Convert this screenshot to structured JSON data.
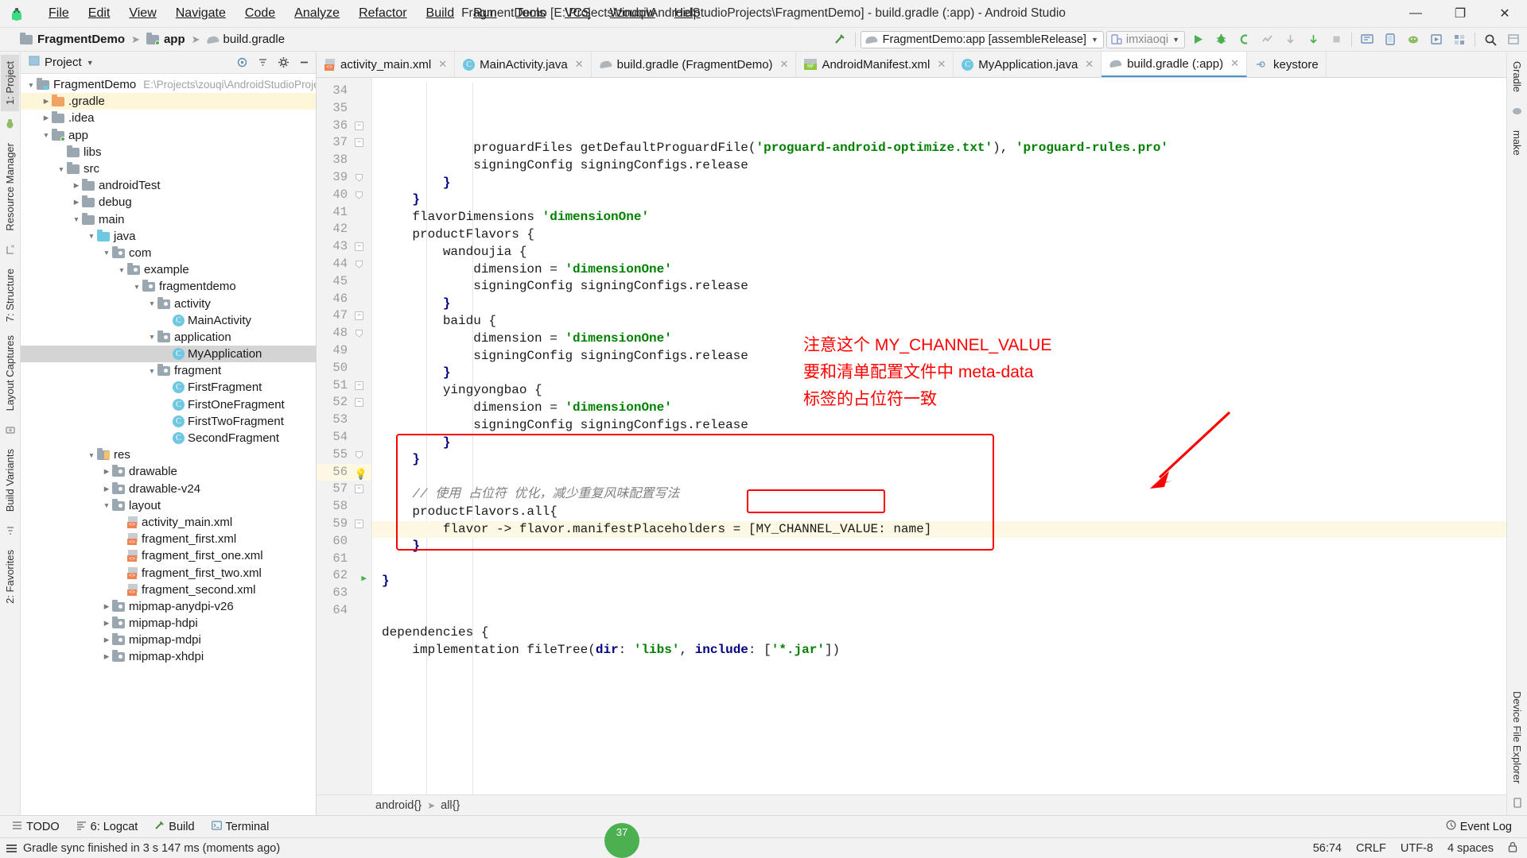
{
  "window": {
    "title": "FragmentDemo [E:\\Projects\\zouqi\\AndroidStudioProjects\\FragmentDemo] - build.gradle (:app) - Android Studio",
    "minimize": "—",
    "maximize": "❐",
    "close": "✕"
  },
  "menubar": [
    {
      "label": "File"
    },
    {
      "label": "Edit"
    },
    {
      "label": "View"
    },
    {
      "label": "Navigate"
    },
    {
      "label": "Code"
    },
    {
      "label": "Analyze"
    },
    {
      "label": "Refactor"
    },
    {
      "label": "Build"
    },
    {
      "label": "Run"
    },
    {
      "label": "Tools"
    },
    {
      "label": "VCS"
    },
    {
      "label": "Window"
    },
    {
      "label": "Help"
    }
  ],
  "breadcrumb": [
    {
      "label": "FragmentDemo",
      "icon": "folder-icon"
    },
    {
      "label": "app",
      "icon": "module-icon"
    },
    {
      "label": "build.gradle",
      "icon": "gradle-icon"
    }
  ],
  "toolbar": {
    "run_config": "FragmentDemo:app [assembleRelease]",
    "device": "imxiaoqi",
    "caret": "▼"
  },
  "left_rail": {
    "top_tab": "1: Project",
    "tabs": [
      "Resource Manager",
      "7: Structure",
      "Layout Captures",
      "Build Variants",
      "2: Favorites"
    ]
  },
  "right_rail": {
    "tabs": [
      "Gradle",
      "make",
      "Device File Explorer",
      "Event Log"
    ]
  },
  "project_panel": {
    "title": "Project",
    "caret": "▼",
    "tree": [
      {
        "depth": 0,
        "arrow": "▼",
        "icon": "folder-project",
        "label": "FragmentDemo",
        "path": "E:\\Projects\\zouqi\\AndroidStudioProject",
        "state": "normal"
      },
      {
        "depth": 1,
        "arrow": "▶",
        "icon": "folder-orange",
        "label": ".gradle",
        "path": "",
        "state": "hl"
      },
      {
        "depth": 1,
        "arrow": "▶",
        "icon": "folder-gray",
        "label": ".idea",
        "path": "",
        "state": "normal"
      },
      {
        "depth": 1,
        "arrow": "▼",
        "icon": "folder-module",
        "label": "app",
        "path": "",
        "state": "normal"
      },
      {
        "depth": 2,
        "arrow": "",
        "icon": "folder-gray",
        "label": "libs",
        "path": "",
        "state": "normal"
      },
      {
        "depth": 2,
        "arrow": "▼",
        "icon": "folder-gray",
        "label": "src",
        "path": "",
        "state": "normal"
      },
      {
        "depth": 3,
        "arrow": "▶",
        "icon": "folder-gray",
        "label": "androidTest",
        "path": "",
        "state": "normal"
      },
      {
        "depth": 3,
        "arrow": "▶",
        "icon": "folder-gray",
        "label": "debug",
        "path": "",
        "state": "normal"
      },
      {
        "depth": 3,
        "arrow": "▼",
        "icon": "folder-gray",
        "label": "main",
        "path": "",
        "state": "normal"
      },
      {
        "depth": 4,
        "arrow": "▼",
        "icon": "folder-blue",
        "label": "java",
        "path": "",
        "state": "normal"
      },
      {
        "depth": 5,
        "arrow": "▼",
        "icon": "folder-pkg",
        "label": "com",
        "path": "",
        "state": "normal"
      },
      {
        "depth": 6,
        "arrow": "▼",
        "icon": "folder-pkg",
        "label": "example",
        "path": "",
        "state": "normal"
      },
      {
        "depth": 7,
        "arrow": "▼",
        "icon": "folder-pkg",
        "label": "fragmentdemo",
        "path": "",
        "state": "normal"
      },
      {
        "depth": 8,
        "arrow": "▼",
        "icon": "folder-pkg",
        "label": "activity",
        "path": "",
        "state": "normal"
      },
      {
        "depth": 9,
        "arrow": "",
        "icon": "class-icon",
        "label": "MainActivity",
        "path": "",
        "state": "normal"
      },
      {
        "depth": 8,
        "arrow": "▼",
        "icon": "folder-pkg",
        "label": "application",
        "path": "",
        "state": "normal"
      },
      {
        "depth": 9,
        "arrow": "",
        "icon": "class-icon",
        "label": "MyApplication",
        "path": "",
        "state": "sel"
      },
      {
        "depth": 8,
        "arrow": "▼",
        "icon": "folder-pkg",
        "label": "fragment",
        "path": "",
        "state": "normal"
      },
      {
        "depth": 9,
        "arrow": "",
        "icon": "class-icon",
        "label": "FirstFragment",
        "path": "",
        "state": "normal"
      },
      {
        "depth": 9,
        "arrow": "",
        "icon": "class-icon",
        "label": "FirstOneFragment",
        "path": "",
        "state": "normal"
      },
      {
        "depth": 9,
        "arrow": "",
        "icon": "class-icon",
        "label": "FirstTwoFragment",
        "path": "",
        "state": "normal"
      },
      {
        "depth": 9,
        "arrow": "",
        "icon": "class-icon",
        "label": "SecondFragment",
        "path": "",
        "state": "normal"
      },
      {
        "depth": 4,
        "arrow": "▼",
        "icon": "folder-res",
        "label": "res",
        "path": "",
        "state": "normal"
      },
      {
        "depth": 5,
        "arrow": "▶",
        "icon": "folder-pkg",
        "label": "drawable",
        "path": "",
        "state": "normal"
      },
      {
        "depth": 5,
        "arrow": "▶",
        "icon": "folder-pkg",
        "label": "drawable-v24",
        "path": "",
        "state": "normal"
      },
      {
        "depth": 5,
        "arrow": "▼",
        "icon": "folder-pkg",
        "label": "layout",
        "path": "",
        "state": "normal"
      },
      {
        "depth": 6,
        "arrow": "",
        "icon": "xml-icon",
        "label": "activity_main.xml",
        "path": "",
        "state": "normal"
      },
      {
        "depth": 6,
        "arrow": "",
        "icon": "xml-icon",
        "label": "fragment_first.xml",
        "path": "",
        "state": "normal"
      },
      {
        "depth": 6,
        "arrow": "",
        "icon": "xml-icon",
        "label": "fragment_first_one.xml",
        "path": "",
        "state": "normal"
      },
      {
        "depth": 6,
        "arrow": "",
        "icon": "xml-icon",
        "label": "fragment_first_two.xml",
        "path": "",
        "state": "normal"
      },
      {
        "depth": 6,
        "arrow": "",
        "icon": "xml-icon",
        "label": "fragment_second.xml",
        "path": "",
        "state": "normal"
      },
      {
        "depth": 5,
        "arrow": "▶",
        "icon": "folder-pkg",
        "label": "mipmap-anydpi-v26",
        "path": "",
        "state": "normal"
      },
      {
        "depth": 5,
        "arrow": "▶",
        "icon": "folder-pkg",
        "label": "mipmap-hdpi",
        "path": "",
        "state": "normal"
      },
      {
        "depth": 5,
        "arrow": "▶",
        "icon": "folder-pkg",
        "label": "mipmap-mdpi",
        "path": "",
        "state": "normal"
      },
      {
        "depth": 5,
        "arrow": "▶",
        "icon": "folder-pkg",
        "label": "mipmap-xhdpi",
        "path": "",
        "state": "normal"
      }
    ]
  },
  "editor_tabs": [
    {
      "label": "activity_main.xml",
      "icon": "xml-icon",
      "active": false
    },
    {
      "label": "MainActivity.java",
      "icon": "class-icon",
      "active": false
    },
    {
      "label": "build.gradle (FragmentDemo)",
      "icon": "gradle-icon",
      "active": false
    },
    {
      "label": "AndroidManifest.xml",
      "icon": "manifest-icon",
      "active": false
    },
    {
      "label": "MyApplication.java",
      "icon": "class-icon",
      "active": false
    },
    {
      "label": "build.gradle (:app)",
      "icon": "gradle-icon",
      "active": true
    },
    {
      "label": "keystore",
      "icon": "keystore-icon",
      "active": false
    }
  ],
  "code": {
    "first_line_number": 34,
    "current_line": 56,
    "lines": [
      {
        "n": 34,
        "fold": "",
        "html": "            <span class='txt'>proguardFiles getDefaultProguardFile</span><span class='txt'>(</span><span class='str'>'proguard-android-optimize.txt'</span><span class='txt'>), </span><span class='str'>'proguard-rules.pro'</span>"
      },
      {
        "n": 35,
        "fold": "",
        "html": "            <span class='txt'>signingConfig signingConfigs.release</span>"
      },
      {
        "n": 36,
        "fold": "minus",
        "html": "        <span class='kw'>}</span>"
      },
      {
        "n": 37,
        "fold": "minus",
        "html": "    <span class='kw'>}</span>"
      },
      {
        "n": 38,
        "fold": "",
        "html": "    <span class='txt'>flavorDimensions </span><span class='str'>'dimensionOne'</span>"
      },
      {
        "n": 39,
        "fold": "tri",
        "html": "    <span class='txt'>productFlavors {</span>"
      },
      {
        "n": 40,
        "fold": "tri",
        "html": "        <span class='txt'>wandoujia {</span>"
      },
      {
        "n": 41,
        "fold": "",
        "html": "            <span class='txt'>dimension = </span><span class='str'>'dimensionOne'</span>"
      },
      {
        "n": 42,
        "fold": "",
        "html": "            <span class='txt'>signingConfig signingConfigs.release</span>"
      },
      {
        "n": 43,
        "fold": "minus",
        "html": "        <span class='kw'>}</span>"
      },
      {
        "n": 44,
        "fold": "tri",
        "html": "        <span class='txt'>baidu {</span>"
      },
      {
        "n": 45,
        "fold": "",
        "html": "            <span class='txt'>dimension = </span><span class='str'>'dimensionOne'</span>"
      },
      {
        "n": 46,
        "fold": "",
        "html": "            <span class='txt'>signingConfig signingConfigs.release</span>"
      },
      {
        "n": 47,
        "fold": "minus",
        "html": "        <span class='kw'>}</span>"
      },
      {
        "n": 48,
        "fold": "tri",
        "html": "        <span class='txt'>yingyongbao {</span>"
      },
      {
        "n": 49,
        "fold": "",
        "html": "            <span class='txt'>dimension = </span><span class='str'>'dimensionOne'</span>"
      },
      {
        "n": 50,
        "fold": "",
        "html": "            <span class='txt'>signingConfig signingConfigs.release</span>"
      },
      {
        "n": 51,
        "fold": "minus",
        "html": "        <span class='kw'>}</span>"
      },
      {
        "n": 52,
        "fold": "minus",
        "html": "    <span class='kw'>}</span>"
      },
      {
        "n": 53,
        "fold": "",
        "html": ""
      },
      {
        "n": 54,
        "fold": "",
        "html": "    <span class='cmt'>// 使用 占位符 优化，减少重复风味配置写法</span>"
      },
      {
        "n": 55,
        "fold": "tri",
        "html": "    <span class='txt'>productFlavors.all{</span>"
      },
      {
        "n": 56,
        "fold": "",
        "html": "        <span class='txt'>flavor -&gt; flavor.manifestPlaceholders = [</span><span class='txt'>MY_CHANNEL_VALUE</span><span class='txt'>: name]</span>"
      },
      {
        "n": 57,
        "fold": "minus",
        "html": "    <span class='kw'>}</span>"
      },
      {
        "n": 58,
        "fold": "",
        "html": ""
      },
      {
        "n": 59,
        "fold": "minus",
        "html": "<span class='kw'>}</span>"
      },
      {
        "n": 60,
        "fold": "",
        "html": ""
      },
      {
        "n": 61,
        "fold": "",
        "html": ""
      },
      {
        "n": 62,
        "fold": "run",
        "html": "<span class='txt'>dependencies {</span>"
      },
      {
        "n": 63,
        "fold": "",
        "html": "    <span class='txt'>implementation fileTree</span><span class='txt'>(</span><span class='kw'>dir</span><span class='txt'>: </span><span class='str'>'libs'</span><span class='txt'>, </span><span class='kw'>include</span><span class='txt'>: [</span><span class='str'>'*.jar'</span><span class='txt'>])</span>"
      },
      {
        "n": 64,
        "fold": "",
        "html": ""
      }
    ]
  },
  "annotation": {
    "text_lines": [
      "注意这个 MY_CHANNEL_VALUE",
      "要和清单配置文件中 meta-data",
      "标签的占位符一致"
    ],
    "color": "#ff0000"
  },
  "bottom_breadcrumb": [
    {
      "label": "android{}"
    },
    {
      "label": "all{}"
    }
  ],
  "tool_window_bar": {
    "buttons": [
      {
        "label": "TODO",
        "icon": "todo-icon"
      },
      {
        "label": "6: Logcat",
        "icon": "logcat-icon"
      },
      {
        "label": "Build",
        "icon": "build-icon"
      },
      {
        "label": "Terminal",
        "icon": "terminal-icon"
      }
    ],
    "event_log": "Event Log"
  },
  "statusbar": {
    "message": "Gradle sync finished in 3 s 147 ms (moments ago)",
    "progress_badge": "37",
    "caret_position": "56:74",
    "line_sep": "CRLF",
    "encoding": "UTF-8",
    "indent": "4 spaces",
    "lock_icon": "lock-icon"
  }
}
